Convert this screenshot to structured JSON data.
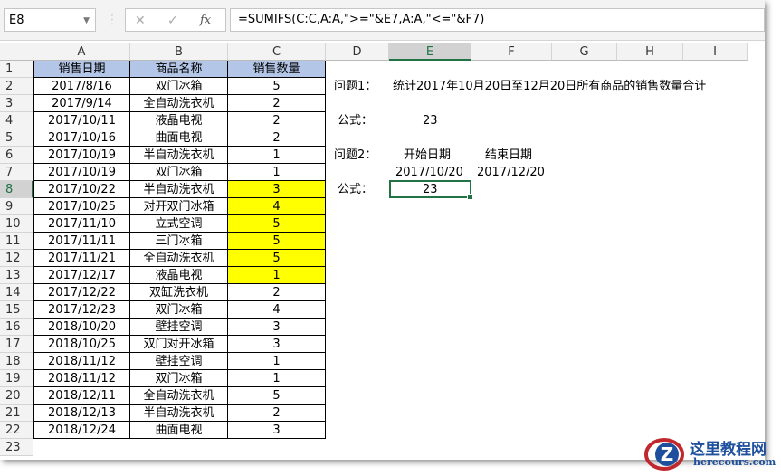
{
  "name_box": "E8",
  "formula": "=SUMIFS(C:C,A:A,\">=\"&E7,A:A,\"<=\"&F7)",
  "columns": [
    "A",
    "B",
    "C",
    "D",
    "E",
    "F",
    "G",
    "H",
    "I"
  ],
  "table": {
    "headers": [
      "销售日期",
      "商品名称",
      "销售数量"
    ],
    "rows": [
      [
        "2017/8/16",
        "双门冰箱",
        "5"
      ],
      [
        "2017/9/14",
        "全自动洗衣机",
        "2"
      ],
      [
        "2017/10/11",
        "液晶电视",
        "2"
      ],
      [
        "2017/10/16",
        "曲面电视",
        "2"
      ],
      [
        "2017/10/19",
        "半自动洗衣机",
        "1"
      ],
      [
        "2017/10/19",
        "双门冰箱",
        "1"
      ],
      [
        "2017/10/22",
        "半自动洗衣机",
        "3"
      ],
      [
        "2017/10/25",
        "对开双门冰箱",
        "4"
      ],
      [
        "2017/11/10",
        "立式空调",
        "5"
      ],
      [
        "2017/11/11",
        "三门冰箱",
        "5"
      ],
      [
        "2017/11/21",
        "全自动洗衣机",
        "5"
      ],
      [
        "2017/12/17",
        "液晶电视",
        "1"
      ],
      [
        "2017/12/22",
        "双缸洗衣机",
        "2"
      ],
      [
        "2017/12/23",
        "双门冰箱",
        "4"
      ],
      [
        "2018/10/20",
        "壁挂空调",
        "3"
      ],
      [
        "2018/10/25",
        "双门对开冰箱",
        "3"
      ],
      [
        "2018/11/12",
        "壁挂空调",
        "1"
      ],
      [
        "2018/11/12",
        "双门冰箱",
        "1"
      ],
      [
        "2018/12/11",
        "全自动洗衣机",
        "5"
      ],
      [
        "2018/12/13",
        "半自动洗衣机",
        "2"
      ],
      [
        "2018/12/24",
        "曲面电视",
        "3"
      ]
    ],
    "highlight_color": "#ffff00"
  },
  "q1": {
    "label": "问题1：",
    "text": "统计2017年10月20日至12月20日所有商品的销售数量合计",
    "formula_label": "公式：",
    "result": "23"
  },
  "q2": {
    "label": "问题2：",
    "start_label": "开始日期",
    "end_label": "结束日期",
    "start": "2017/10/20",
    "end": "2017/12/20",
    "formula_label": "公式：",
    "result": "23"
  },
  "watermark": {
    "name": "这里教程网",
    "url": "herecours.com"
  }
}
